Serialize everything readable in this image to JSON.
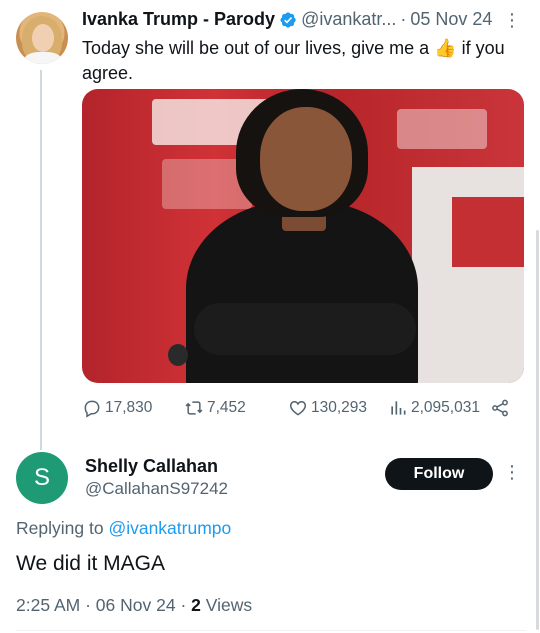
{
  "tweet": {
    "author_name": "Ivanka Trump - Parody",
    "handle": "@ivankatr...",
    "separator": "·",
    "date": "05 Nov 24",
    "text_before_emoji": "Today she will be out of our lives, give me a ",
    "emoji": "👍",
    "text_after_emoji": " if you agree.",
    "stats": {
      "replies": "17,830",
      "reposts": "7,452",
      "likes": "130,293",
      "views": "2,095,031"
    }
  },
  "reply": {
    "avatar_letter": "S",
    "author_name": "Shelly Callahan",
    "handle": "@CallahanS97242",
    "follow_label": "Follow",
    "replying_prefix": "Replying to",
    "replying_to": "@ivankatrumpo",
    "text": "We did it MAGA",
    "time": "2:25 AM",
    "separator": "·",
    "date": "06 Nov 24",
    "views_count": "2",
    "views_label": "Views"
  },
  "icons": {
    "verified": "verified-badge-icon",
    "more": "more-dots-icon",
    "reply": "reply-icon",
    "repost": "repost-icon",
    "like": "heart-icon",
    "views": "bar-chart-icon",
    "share": "share-icon"
  },
  "colors": {
    "accent": "#1d9bf0",
    "text_secondary": "#536471",
    "avatar_reply_bg": "#1e9b74",
    "follow_bg": "#0f1419"
  }
}
